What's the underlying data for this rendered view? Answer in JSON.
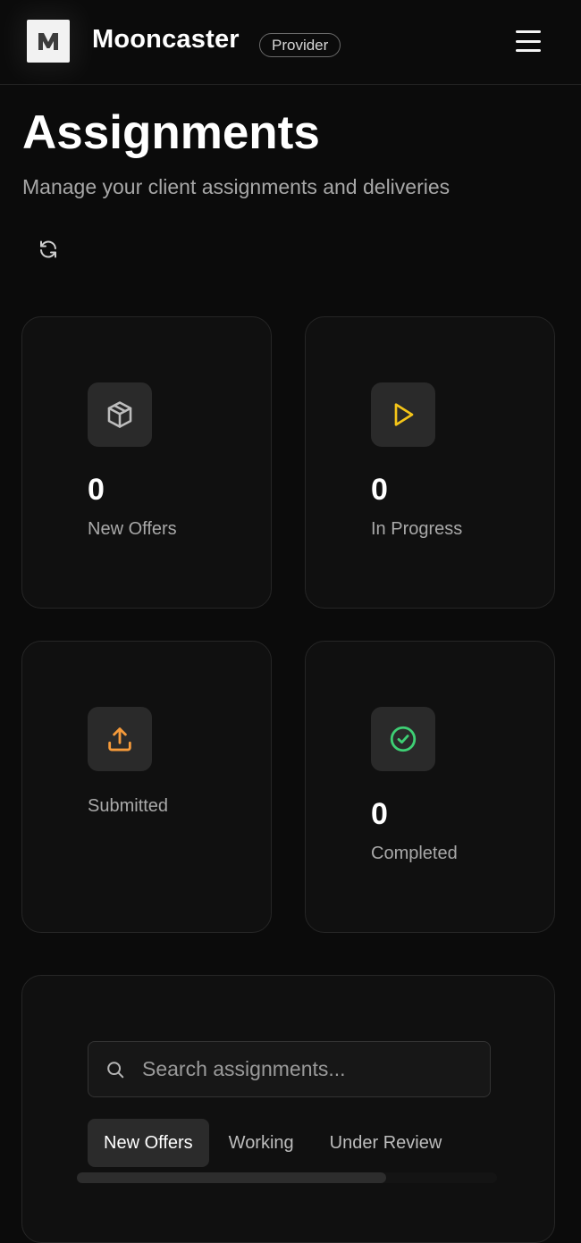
{
  "header": {
    "brand": "Mooncaster",
    "badge": "Provider",
    "logo_letter": "M"
  },
  "page": {
    "title": "Assignments",
    "subtitle": "Manage your client assignments and deliveries"
  },
  "stats": [
    {
      "label": "New Offers",
      "count": "0",
      "icon": "package-icon",
      "color": "#bdbdbd"
    },
    {
      "label": "In Progress",
      "count": "0",
      "icon": "play-icon",
      "color": "#f5c518"
    },
    {
      "label": "Submitted",
      "count": "",
      "icon": "upload-icon",
      "color": "#f59a3a"
    },
    {
      "label": "Completed",
      "count": "0",
      "icon": "check-circle-icon",
      "color": "#3ecf74"
    }
  ],
  "search": {
    "placeholder": "Search assignments..."
  },
  "tabs": [
    {
      "label": "New Offers",
      "active": true
    },
    {
      "label": "Working",
      "active": false
    },
    {
      "label": "Under Review",
      "active": false
    }
  ]
}
